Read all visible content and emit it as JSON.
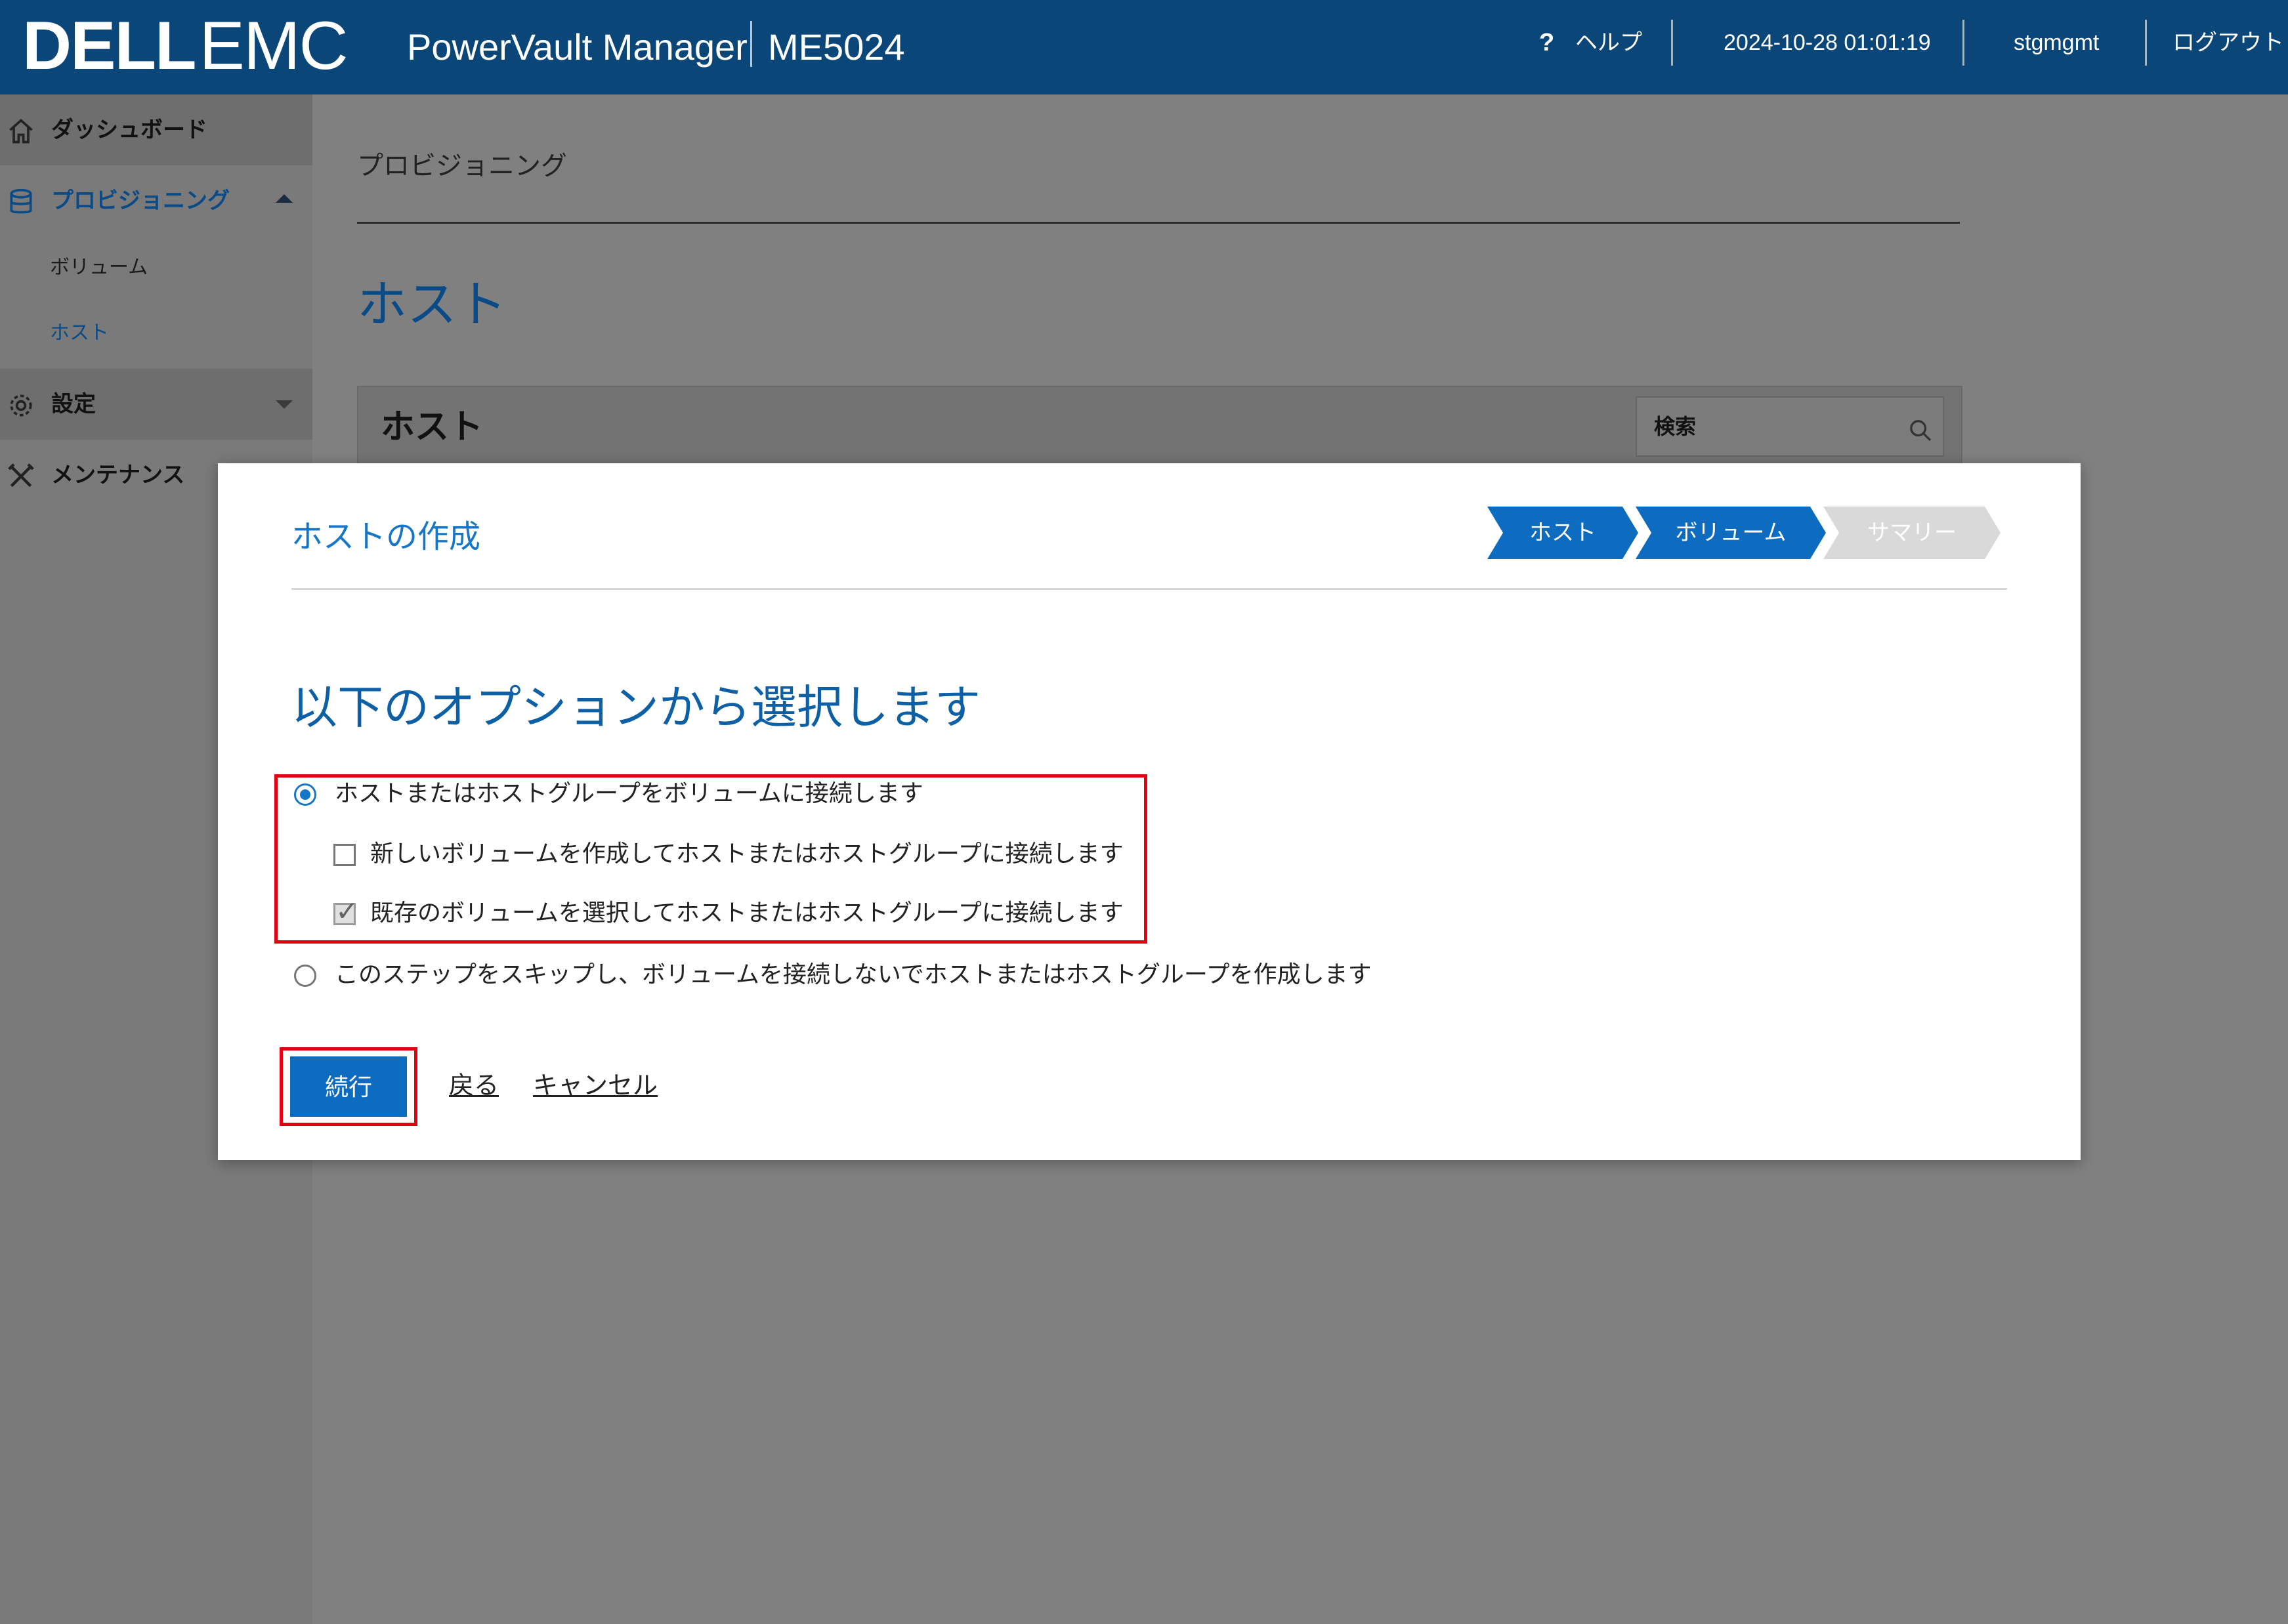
{
  "header": {
    "logo_dell": "DELL",
    "logo_emc": "EMC",
    "app_title": "PowerVault Manager",
    "model": "ME5024",
    "help_icon": "?",
    "help_label": "ヘルプ",
    "datetime": "2024-10-28 01:01:19",
    "user": "stgmgmt",
    "logout": "ログアウト"
  },
  "sidebar": {
    "dashboard": "ダッシュボード",
    "provisioning": "プロビジョニング",
    "volume": "ボリューム",
    "host": "ホスト",
    "settings": "設定",
    "maintenance": "メンテナンス"
  },
  "main": {
    "breadcrumb": "プロビジョニング",
    "heading": "ホスト",
    "panel_title": "ホスト",
    "search_placeholder": "検索"
  },
  "modal": {
    "title": "ホストの作成",
    "steps": [
      "ホスト",
      "ボリューム",
      "サマリー"
    ],
    "heading": "以下のオプションから選択します",
    "option_connect": "ホストまたはホストグループをボリュームに接続します",
    "option_new_volume": "新しいボリュームを作成してホストまたはホストグループに接続します",
    "option_existing_volume": "既存のボリュームを選択してホストまたはホストグループに接続します",
    "option_skip": "このステップをスキップし、ボリュームを接続しないでホストまたはホストグループを作成します",
    "continue": "続行",
    "back": "戻る",
    "cancel": "キャンセル"
  },
  "colors": {
    "header_bg": "#0a4678",
    "accent": "#0e6cc0",
    "highlight": "#e00010"
  }
}
